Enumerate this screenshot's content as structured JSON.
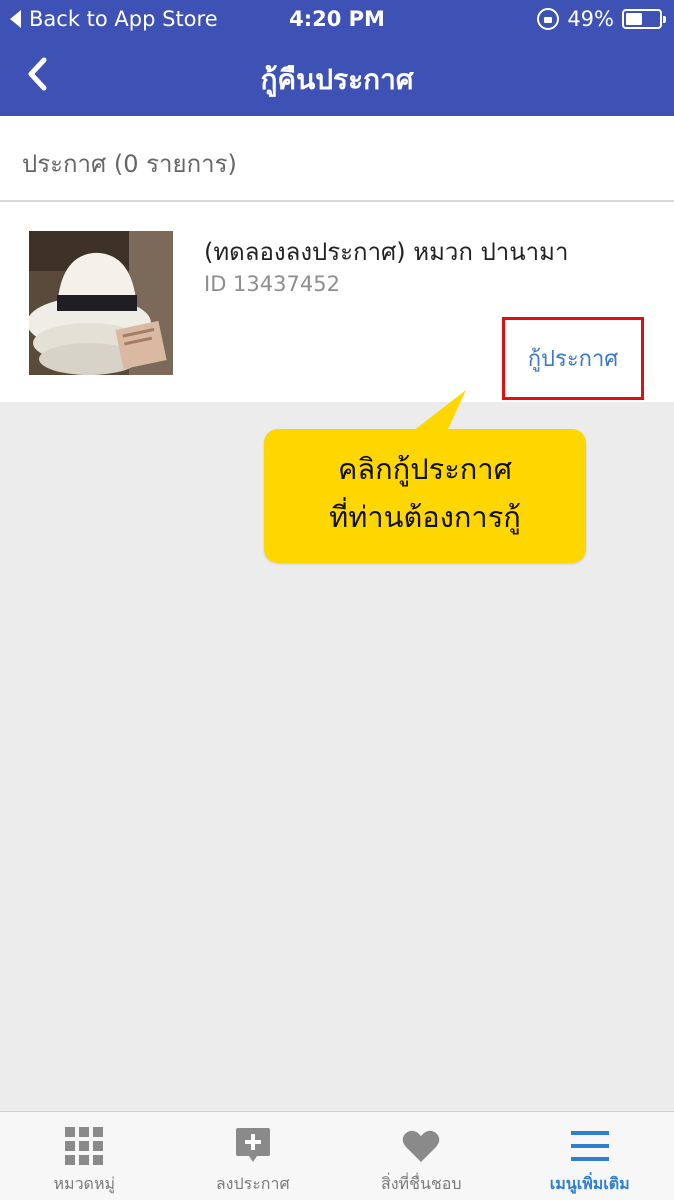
{
  "status_bar": {
    "back_label": "Back to App Store",
    "time": "4:20 PM",
    "battery": "49%",
    "battery_level": 0.49
  },
  "nav": {
    "title": "กู้คืนประกาศ",
    "back_icon": "chevron-left-icon"
  },
  "list": {
    "count_label": "ประกาศ (0 รายการ)",
    "items": [
      {
        "title": "(ทดลองลงประกาศ) หมวก ปานามา",
        "id_label": "ID 13437452",
        "action_label": "กู้ประกาศ"
      }
    ]
  },
  "tooltip": {
    "line1": "คลิกกู้ประกาศ",
    "line2": "ที่ท่านต้องการกู้"
  },
  "tabs": [
    {
      "label": "หมวดหมู่",
      "icon": "grid-icon",
      "active": false
    },
    {
      "label": "ลงประกาศ",
      "icon": "post-add-icon",
      "active": false
    },
    {
      "label": "สิ่งที่ชื่นชอบ",
      "icon": "heart-icon",
      "active": false
    },
    {
      "label": "เมนูเพิ่มเติม",
      "icon": "menu-icon",
      "active": true
    }
  ],
  "colors": {
    "header": "#3e51b5",
    "accent": "#2f7fd0",
    "highlight_border": "#e01010",
    "tooltip": "#ffd700"
  }
}
